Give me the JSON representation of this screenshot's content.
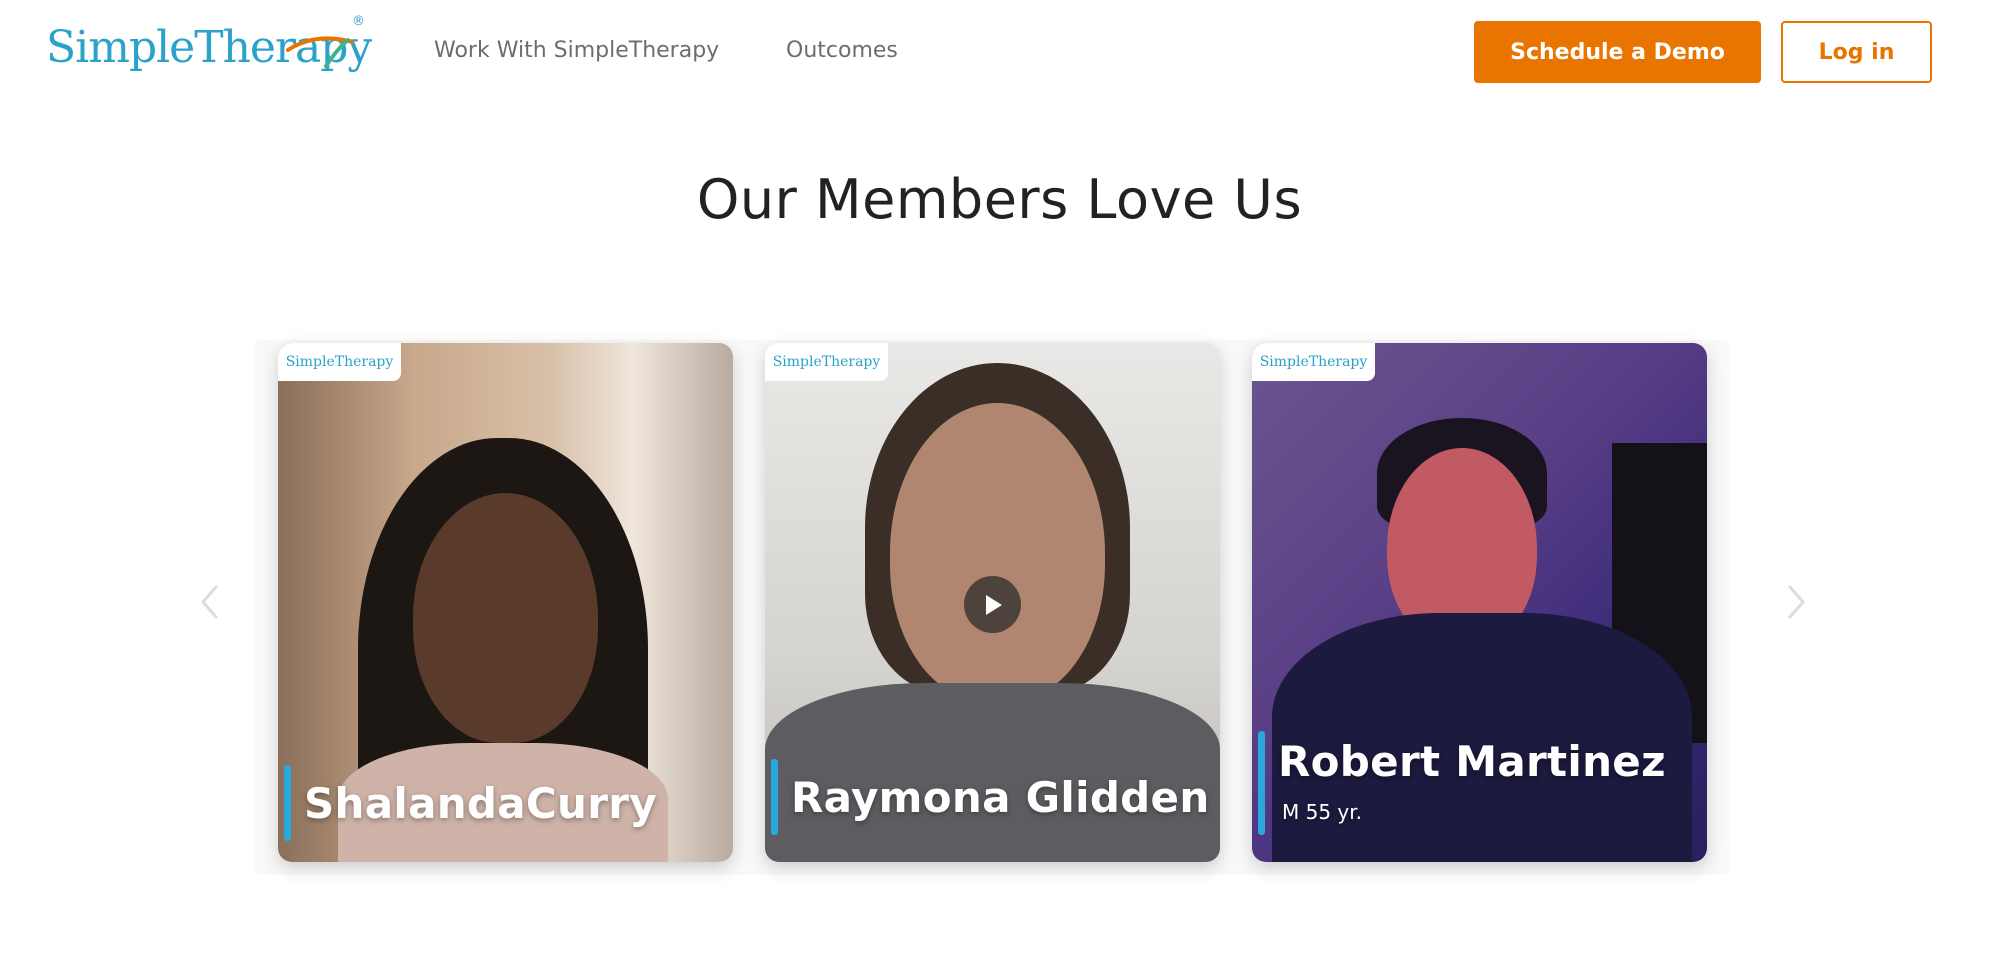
{
  "header": {
    "logo": {
      "part1": "Simple",
      "part2": "Therapy",
      "reg": "®"
    },
    "nav": [
      {
        "label": "Work With SimpleTherapy"
      },
      {
        "label": "Outcomes"
      }
    ],
    "demo_label": "Schedule a Demo",
    "login_label": "Log in"
  },
  "section": {
    "title": "Our Members Love Us"
  },
  "carousel": {
    "prev_icon": "chevron-left-icon",
    "next_icon": "chevron-right-icon",
    "cards": [
      {
        "badge": "SimpleTherapy",
        "name": "ShalandaCurry",
        "meta": ""
      },
      {
        "badge": "SimpleTherapy",
        "name": "Raymona Glidden",
        "meta": "",
        "play_icon": "play-icon"
      },
      {
        "badge": "SimpleTherapy",
        "name": "Robert Martinez",
        "meta": "M 55 yr."
      }
    ]
  },
  "colors": {
    "brand_orange": "#ea7400",
    "brand_teal": "#2aa2c9",
    "accent_bar": "#28a8dc"
  }
}
